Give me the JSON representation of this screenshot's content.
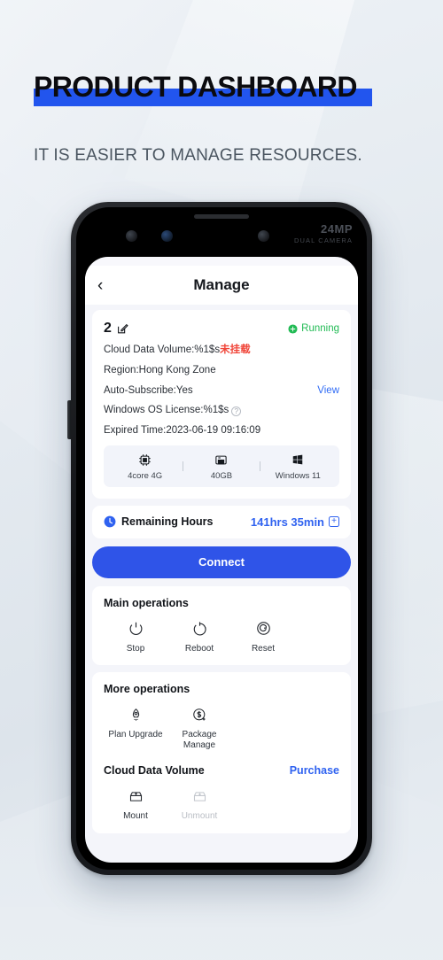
{
  "page": {
    "title": "PRODUCT DASHBOARD",
    "subtitle": "IT IS EASIER TO MANAGE RESOURCES.",
    "accent_blue": "#2255ee"
  },
  "phone": {
    "camera_mp": "24MP",
    "camera_sub": "DUAL CAMERA"
  },
  "app": {
    "nav": {
      "back_icon": "chevron-left-icon",
      "title": "Manage"
    },
    "instance": {
      "id": "2",
      "edit_icon": "edit-square-icon",
      "status": "Running",
      "status_color": "#22bb55",
      "details": [
        {
          "label": "Cloud Data Volume:",
          "value": "%1$s",
          "warning": "未挂载"
        },
        {
          "label": "Region:",
          "value": "Hong Kong Zone"
        },
        {
          "label": "Auto-Subscribe:",
          "value": "Yes",
          "action": "View"
        },
        {
          "label": "Windows OS License:",
          "value": "%1$s",
          "help_icon": "question-circle-icon"
        },
        {
          "label": "Expired Time:",
          "value": "2023-06-19 09:16:09"
        }
      ],
      "specs": [
        {
          "icon": "cpu-icon",
          "label": "4core 4G"
        },
        {
          "icon": "storage-icon",
          "label": "40GB"
        },
        {
          "icon": "windows-icon",
          "label": "Windows 11"
        }
      ]
    },
    "remaining": {
      "icon": "clock-icon",
      "label": "Remaining Hours",
      "value": "141hrs 35min",
      "add_icon": "plus-box-icon"
    },
    "connect_label": "Connect",
    "main_operations": {
      "title": "Main operations",
      "items": [
        {
          "icon": "power-off-icon",
          "label": "Stop"
        },
        {
          "icon": "reboot-icon",
          "label": "Reboot"
        },
        {
          "icon": "reset-icon",
          "label": "Reset"
        }
      ]
    },
    "more_operations": {
      "title": "More operations",
      "items": [
        {
          "icon": "rocket-icon",
          "label": "Plan Upgrade"
        },
        {
          "icon": "dollar-plus-icon",
          "label": "Package Manage"
        }
      ]
    },
    "cloud_data_volume": {
      "title": "Cloud Data Volume",
      "action": "Purchase",
      "items": [
        {
          "icon": "mount-icon",
          "label": "Mount",
          "disabled": false
        },
        {
          "icon": "unmount-icon",
          "label": "Unmount",
          "disabled": true
        }
      ]
    }
  }
}
